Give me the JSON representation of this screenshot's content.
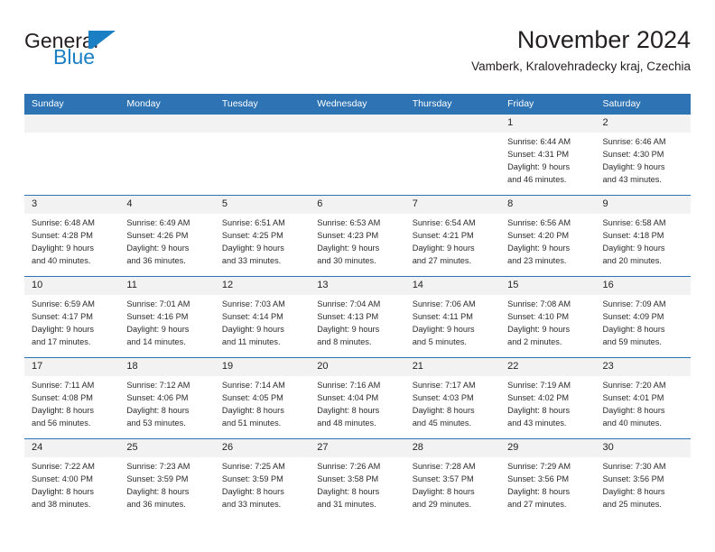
{
  "logo": {
    "word_top": "General",
    "word_bottom": "Blue",
    "mark_icon": "blue-triangle-flag-icon",
    "brand_color": "#1b7fc4"
  },
  "header": {
    "title": "November 2024",
    "subtitle": "Vamberk, Kralovehradecky kraj, Czechia"
  },
  "theme": {
    "header_row_color": "#2e74b5",
    "daynum_band_color": "#f2f2f2",
    "text_color": "#231f20"
  },
  "calendar": {
    "weekday_headers": [
      "Sunday",
      "Monday",
      "Tuesday",
      "Wednesday",
      "Thursday",
      "Friday",
      "Saturday"
    ],
    "weeks": [
      [
        {
          "day": "",
          "sunrise": "",
          "sunset": "",
          "daylight1": "",
          "daylight2": ""
        },
        {
          "day": "",
          "sunrise": "",
          "sunset": "",
          "daylight1": "",
          "daylight2": ""
        },
        {
          "day": "",
          "sunrise": "",
          "sunset": "",
          "daylight1": "",
          "daylight2": ""
        },
        {
          "day": "",
          "sunrise": "",
          "sunset": "",
          "daylight1": "",
          "daylight2": ""
        },
        {
          "day": "",
          "sunrise": "",
          "sunset": "",
          "daylight1": "",
          "daylight2": ""
        },
        {
          "day": "1",
          "sunrise": "Sunrise: 6:44 AM",
          "sunset": "Sunset: 4:31 PM",
          "daylight1": "Daylight: 9 hours",
          "daylight2": "and 46 minutes."
        },
        {
          "day": "2",
          "sunrise": "Sunrise: 6:46 AM",
          "sunset": "Sunset: 4:30 PM",
          "daylight1": "Daylight: 9 hours",
          "daylight2": "and 43 minutes."
        }
      ],
      [
        {
          "day": "3",
          "sunrise": "Sunrise: 6:48 AM",
          "sunset": "Sunset: 4:28 PM",
          "daylight1": "Daylight: 9 hours",
          "daylight2": "and 40 minutes."
        },
        {
          "day": "4",
          "sunrise": "Sunrise: 6:49 AM",
          "sunset": "Sunset: 4:26 PM",
          "daylight1": "Daylight: 9 hours",
          "daylight2": "and 36 minutes."
        },
        {
          "day": "5",
          "sunrise": "Sunrise: 6:51 AM",
          "sunset": "Sunset: 4:25 PM",
          "daylight1": "Daylight: 9 hours",
          "daylight2": "and 33 minutes."
        },
        {
          "day": "6",
          "sunrise": "Sunrise: 6:53 AM",
          "sunset": "Sunset: 4:23 PM",
          "daylight1": "Daylight: 9 hours",
          "daylight2": "and 30 minutes."
        },
        {
          "day": "7",
          "sunrise": "Sunrise: 6:54 AM",
          "sunset": "Sunset: 4:21 PM",
          "daylight1": "Daylight: 9 hours",
          "daylight2": "and 27 minutes."
        },
        {
          "day": "8",
          "sunrise": "Sunrise: 6:56 AM",
          "sunset": "Sunset: 4:20 PM",
          "daylight1": "Daylight: 9 hours",
          "daylight2": "and 23 minutes."
        },
        {
          "day": "9",
          "sunrise": "Sunrise: 6:58 AM",
          "sunset": "Sunset: 4:18 PM",
          "daylight1": "Daylight: 9 hours",
          "daylight2": "and 20 minutes."
        }
      ],
      [
        {
          "day": "10",
          "sunrise": "Sunrise: 6:59 AM",
          "sunset": "Sunset: 4:17 PM",
          "daylight1": "Daylight: 9 hours",
          "daylight2": "and 17 minutes."
        },
        {
          "day": "11",
          "sunrise": "Sunrise: 7:01 AM",
          "sunset": "Sunset: 4:16 PM",
          "daylight1": "Daylight: 9 hours",
          "daylight2": "and 14 minutes."
        },
        {
          "day": "12",
          "sunrise": "Sunrise: 7:03 AM",
          "sunset": "Sunset: 4:14 PM",
          "daylight1": "Daylight: 9 hours",
          "daylight2": "and 11 minutes."
        },
        {
          "day": "13",
          "sunrise": "Sunrise: 7:04 AM",
          "sunset": "Sunset: 4:13 PM",
          "daylight1": "Daylight: 9 hours",
          "daylight2": "and 8 minutes."
        },
        {
          "day": "14",
          "sunrise": "Sunrise: 7:06 AM",
          "sunset": "Sunset: 4:11 PM",
          "daylight1": "Daylight: 9 hours",
          "daylight2": "and 5 minutes."
        },
        {
          "day": "15",
          "sunrise": "Sunrise: 7:08 AM",
          "sunset": "Sunset: 4:10 PM",
          "daylight1": "Daylight: 9 hours",
          "daylight2": "and 2 minutes."
        },
        {
          "day": "16",
          "sunrise": "Sunrise: 7:09 AM",
          "sunset": "Sunset: 4:09 PM",
          "daylight1": "Daylight: 8 hours",
          "daylight2": "and 59 minutes."
        }
      ],
      [
        {
          "day": "17",
          "sunrise": "Sunrise: 7:11 AM",
          "sunset": "Sunset: 4:08 PM",
          "daylight1": "Daylight: 8 hours",
          "daylight2": "and 56 minutes."
        },
        {
          "day": "18",
          "sunrise": "Sunrise: 7:12 AM",
          "sunset": "Sunset: 4:06 PM",
          "daylight1": "Daylight: 8 hours",
          "daylight2": "and 53 minutes."
        },
        {
          "day": "19",
          "sunrise": "Sunrise: 7:14 AM",
          "sunset": "Sunset: 4:05 PM",
          "daylight1": "Daylight: 8 hours",
          "daylight2": "and 51 minutes."
        },
        {
          "day": "20",
          "sunrise": "Sunrise: 7:16 AM",
          "sunset": "Sunset: 4:04 PM",
          "daylight1": "Daylight: 8 hours",
          "daylight2": "and 48 minutes."
        },
        {
          "day": "21",
          "sunrise": "Sunrise: 7:17 AM",
          "sunset": "Sunset: 4:03 PM",
          "daylight1": "Daylight: 8 hours",
          "daylight2": "and 45 minutes."
        },
        {
          "day": "22",
          "sunrise": "Sunrise: 7:19 AM",
          "sunset": "Sunset: 4:02 PM",
          "daylight1": "Daylight: 8 hours",
          "daylight2": "and 43 minutes."
        },
        {
          "day": "23",
          "sunrise": "Sunrise: 7:20 AM",
          "sunset": "Sunset: 4:01 PM",
          "daylight1": "Daylight: 8 hours",
          "daylight2": "and 40 minutes."
        }
      ],
      [
        {
          "day": "24",
          "sunrise": "Sunrise: 7:22 AM",
          "sunset": "Sunset: 4:00 PM",
          "daylight1": "Daylight: 8 hours",
          "daylight2": "and 38 minutes."
        },
        {
          "day": "25",
          "sunrise": "Sunrise: 7:23 AM",
          "sunset": "Sunset: 3:59 PM",
          "daylight1": "Daylight: 8 hours",
          "daylight2": "and 36 minutes."
        },
        {
          "day": "26",
          "sunrise": "Sunrise: 7:25 AM",
          "sunset": "Sunset: 3:59 PM",
          "daylight1": "Daylight: 8 hours",
          "daylight2": "and 33 minutes."
        },
        {
          "day": "27",
          "sunrise": "Sunrise: 7:26 AM",
          "sunset": "Sunset: 3:58 PM",
          "daylight1": "Daylight: 8 hours",
          "daylight2": "and 31 minutes."
        },
        {
          "day": "28",
          "sunrise": "Sunrise: 7:28 AM",
          "sunset": "Sunset: 3:57 PM",
          "daylight1": "Daylight: 8 hours",
          "daylight2": "and 29 minutes."
        },
        {
          "day": "29",
          "sunrise": "Sunrise: 7:29 AM",
          "sunset": "Sunset: 3:56 PM",
          "daylight1": "Daylight: 8 hours",
          "daylight2": "and 27 minutes."
        },
        {
          "day": "30",
          "sunrise": "Sunrise: 7:30 AM",
          "sunset": "Sunset: 3:56 PM",
          "daylight1": "Daylight: 8 hours",
          "daylight2": "and 25 minutes."
        }
      ]
    ]
  }
}
